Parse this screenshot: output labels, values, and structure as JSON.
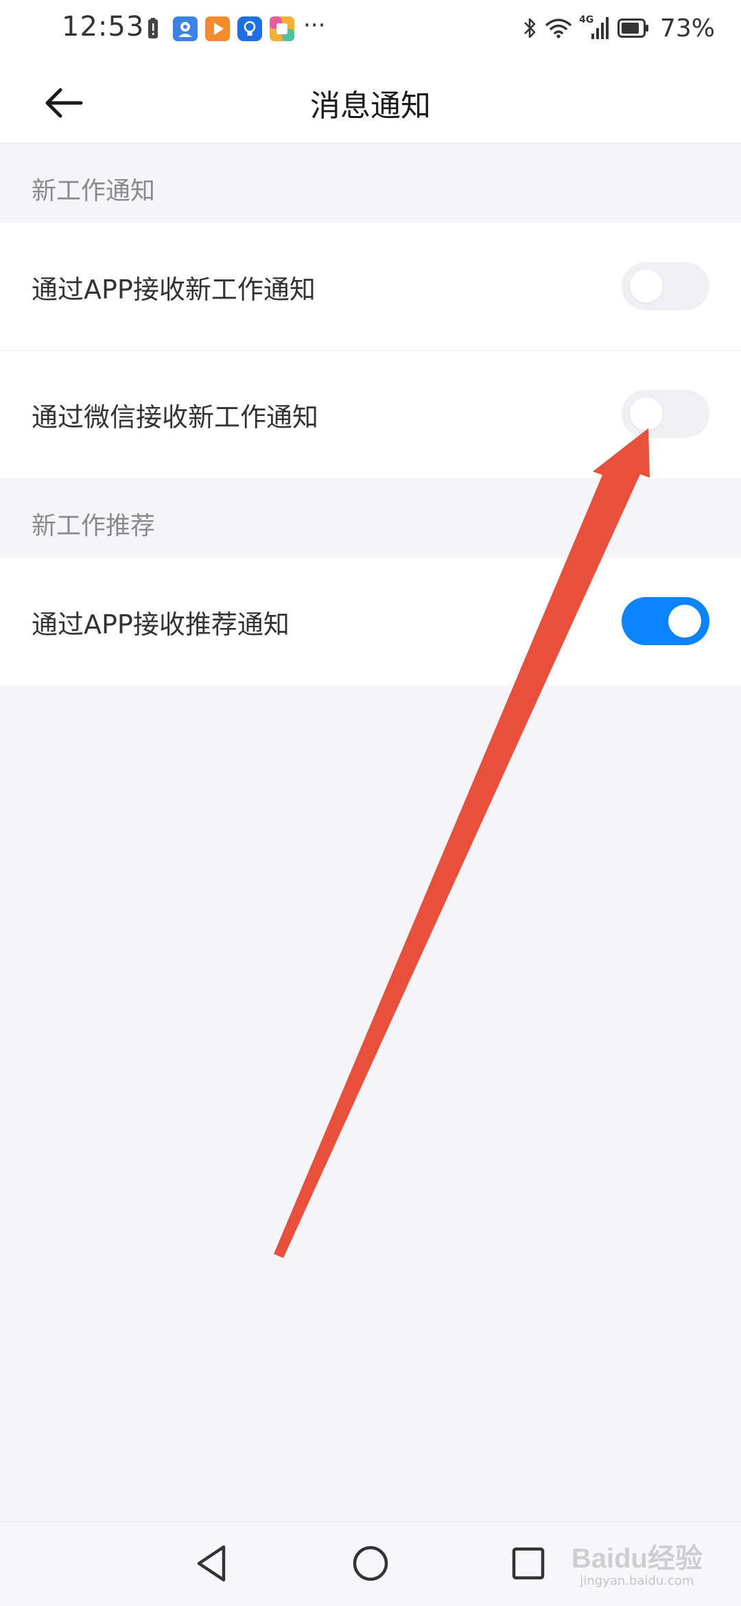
{
  "status_bar": {
    "time": "12:53",
    "battery_percent": "73%",
    "network_label": "4G",
    "more_indicator": "···",
    "notification_icons": [
      "battery-alert-icon",
      "maps-icon",
      "video-play-icon",
      "lightbulb-icon",
      "puzzle-app-icon"
    ]
  },
  "header": {
    "title": "消息通知",
    "back_icon": "arrow-left-icon"
  },
  "sections": [
    {
      "title": "新工作通知",
      "items": [
        {
          "label": "通过APP接收新工作通知",
          "enabled": false
        },
        {
          "label": "通过微信接收新工作通知",
          "enabled": false
        }
      ]
    },
    {
      "title": "新工作推荐",
      "items": [
        {
          "label": "通过APP接收推荐通知",
          "enabled": true
        }
      ]
    }
  ],
  "colors": {
    "toggle_on": "#0a84ff",
    "toggle_off": "#f0f0f3",
    "annotation_arrow": "#e8503c"
  },
  "watermark": {
    "main": "Baidu经验",
    "sub": "jingyan.baidu.com"
  }
}
